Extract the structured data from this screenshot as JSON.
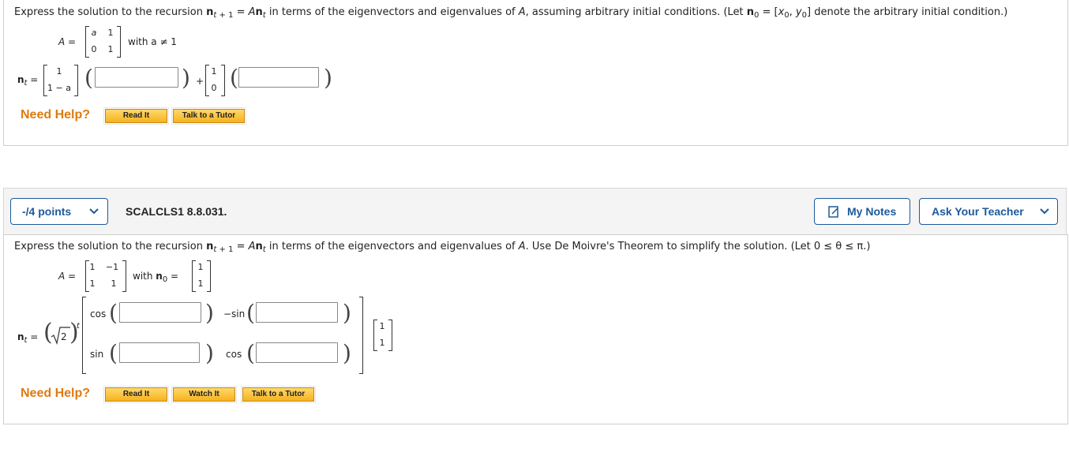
{
  "q1": {
    "prompt_a": "Express the solution to the recursion",
    "prompt_b": "in terms of the eigenvectors and eigenvalues of",
    "prompt_c": "assuming arbitrary initial conditions. (Let",
    "prompt_d": "denote the arbitrary initial condition.)",
    "matrix_A": [
      "a",
      "1",
      "0",
      "1"
    ],
    "condition": "with a ≠ 1",
    "vec1": [
      "1",
      "1 − a"
    ],
    "vec2": [
      "1",
      "0"
    ],
    "plus": "+",
    "answers": [
      "",
      ""
    ]
  },
  "q2": {
    "points": "-/4 points",
    "code": "SCALCLS1 8.8.031.",
    "my_notes": "My Notes",
    "ask_teacher": "Ask Your Teacher",
    "prompt_a": "Express the solution to the recursion",
    "prompt_b": "in terms of the eigenvectors and eigenvalues of",
    "prompt_c": "Use De Moivre's Theorem to simplify the solution.  (Let 0 ≤ θ ≤ π.)",
    "matrix_A": [
      "1",
      "−1",
      "1",
      "1"
    ],
    "with": "with",
    "n0": [
      "1",
      "1"
    ],
    "labels": {
      "cos1": "cos",
      "negsin": "−sin",
      "sin": "sin",
      "cos2": "cos"
    },
    "sqrt2": "2",
    "exp": "t",
    "vec": [
      "1",
      "1"
    ],
    "answers": [
      "",
      "",
      "",
      ""
    ]
  },
  "help": {
    "label": "Need Help?",
    "read_it": "Read It",
    "watch_it": "Watch It",
    "talk_tutor": "Talk to a Tutor"
  },
  "colors": {
    "link_blue": "#1d5a9b",
    "help_orange": "#e07a0f",
    "button_gold": "#f6b21d"
  }
}
